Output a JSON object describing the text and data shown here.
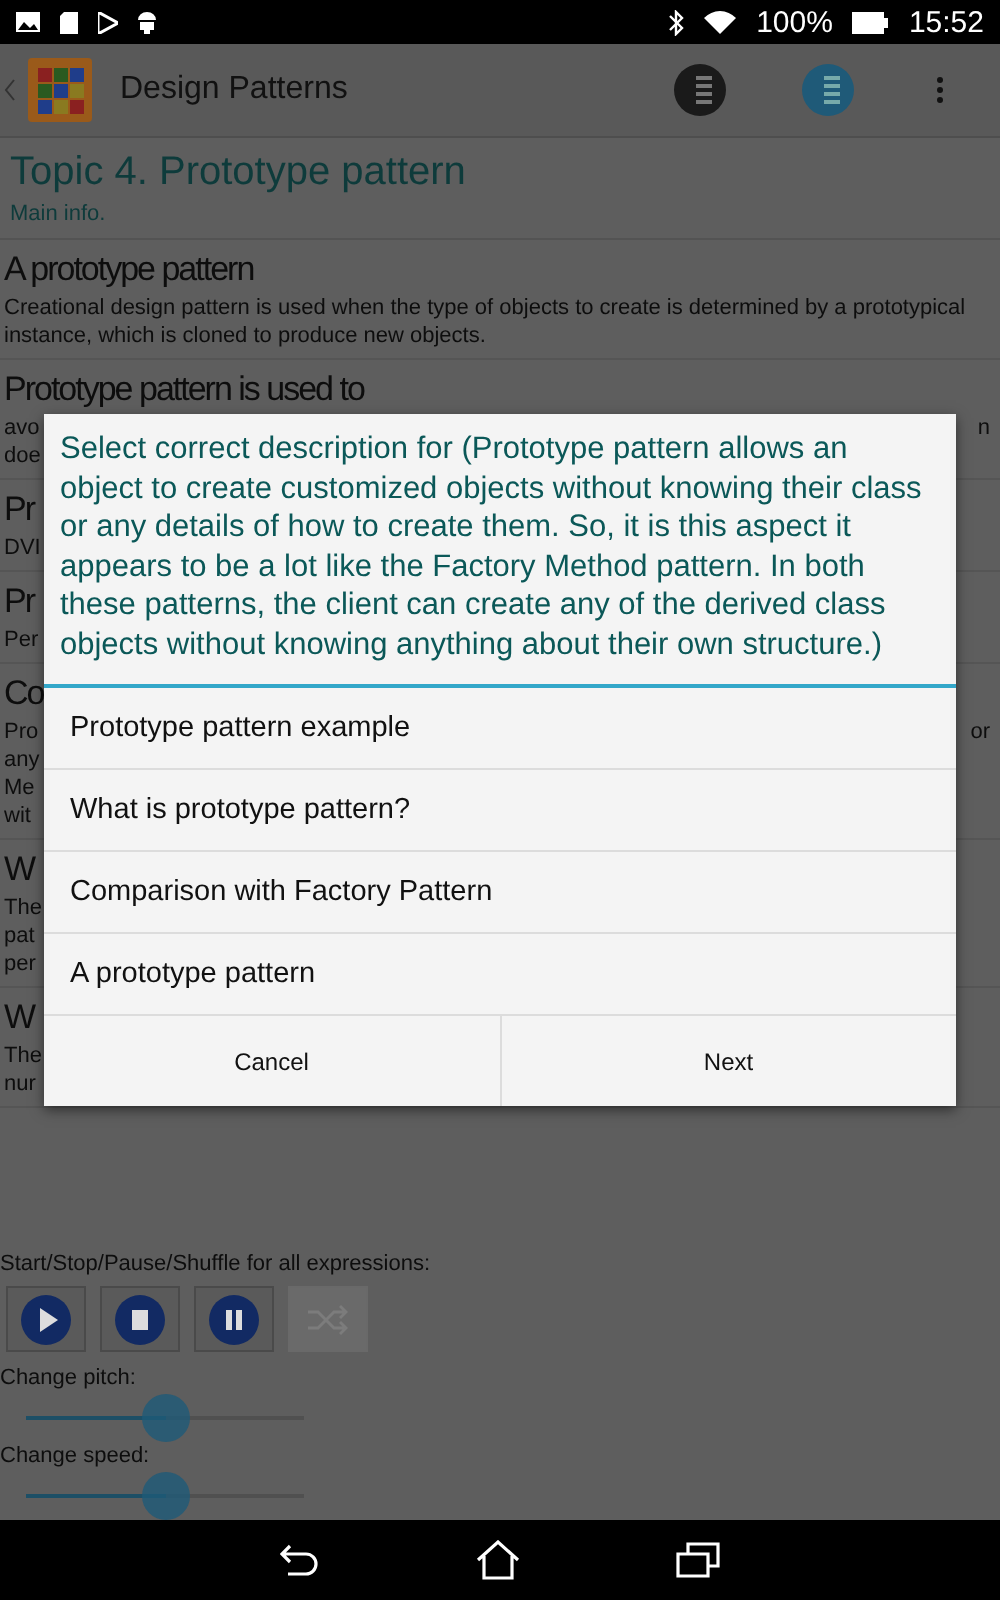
{
  "status_bar": {
    "battery": "100%",
    "time": "15:52"
  },
  "app_bar": {
    "title": "Design Patterns"
  },
  "topic": {
    "title": "Topic 4. Prototype pattern",
    "subtitle": "Main info."
  },
  "sections": [
    {
      "title": "A prototype pattern",
      "lines": [
        {
          "text": "Creational design pattern is used when the type of objects to create is determined by a prototypical instance, which is cloned to produce new objects."
        }
      ]
    },
    {
      "title": "Prototype pattern is used to",
      "lines": [
        {
          "text": "avo",
          "right": "n"
        },
        {
          "text": "doe"
        }
      ]
    },
    {
      "title": "Pr",
      "lines": [
        {
          "text": "DVI"
        }
      ]
    },
    {
      "title": "Pr",
      "lines": [
        {
          "text": "Per"
        }
      ]
    },
    {
      "title": "Co",
      "lines": [
        {
          "text": "Pro",
          "right": "or"
        },
        {
          "text": "any"
        },
        {
          "text": "Me"
        },
        {
          "text": "wit"
        }
      ]
    },
    {
      "title": "W",
      "lines": [
        {
          "text": "The"
        },
        {
          "text": "pat"
        },
        {
          "text": "per"
        }
      ]
    },
    {
      "title": "W",
      "lines": [
        {
          "text": "The"
        },
        {
          "text": "nur"
        }
      ]
    }
  ],
  "playback": {
    "label": "Start/Stop/Pause/Shuffle for all expressions:",
    "buttons": [
      {
        "kind": "play",
        "disabled": false
      },
      {
        "kind": "stop",
        "disabled": false
      },
      {
        "kind": "pause",
        "disabled": false
      },
      {
        "kind": "shuffle",
        "disabled": true
      }
    ]
  },
  "sliders": [
    {
      "label": "Change pitch:",
      "level": 0.5
    },
    {
      "label": "Change speed:",
      "level": 0.5
    }
  ],
  "dialog": {
    "question": "Select correct description for (Prototype pattern allows an object to create customized objects without knowing their class or any details of how to create them. So, it is this aspect it appears to be a lot like the Factory Method pattern. In both these patterns, the client can create any of the derived class objects without knowing anything about their own structure.)",
    "options": [
      "Prototype pattern example",
      "What is prototype pattern?",
      "Comparison with Factory Pattern",
      "A prototype pattern"
    ],
    "buttons": [
      "Cancel",
      "Next"
    ]
  }
}
